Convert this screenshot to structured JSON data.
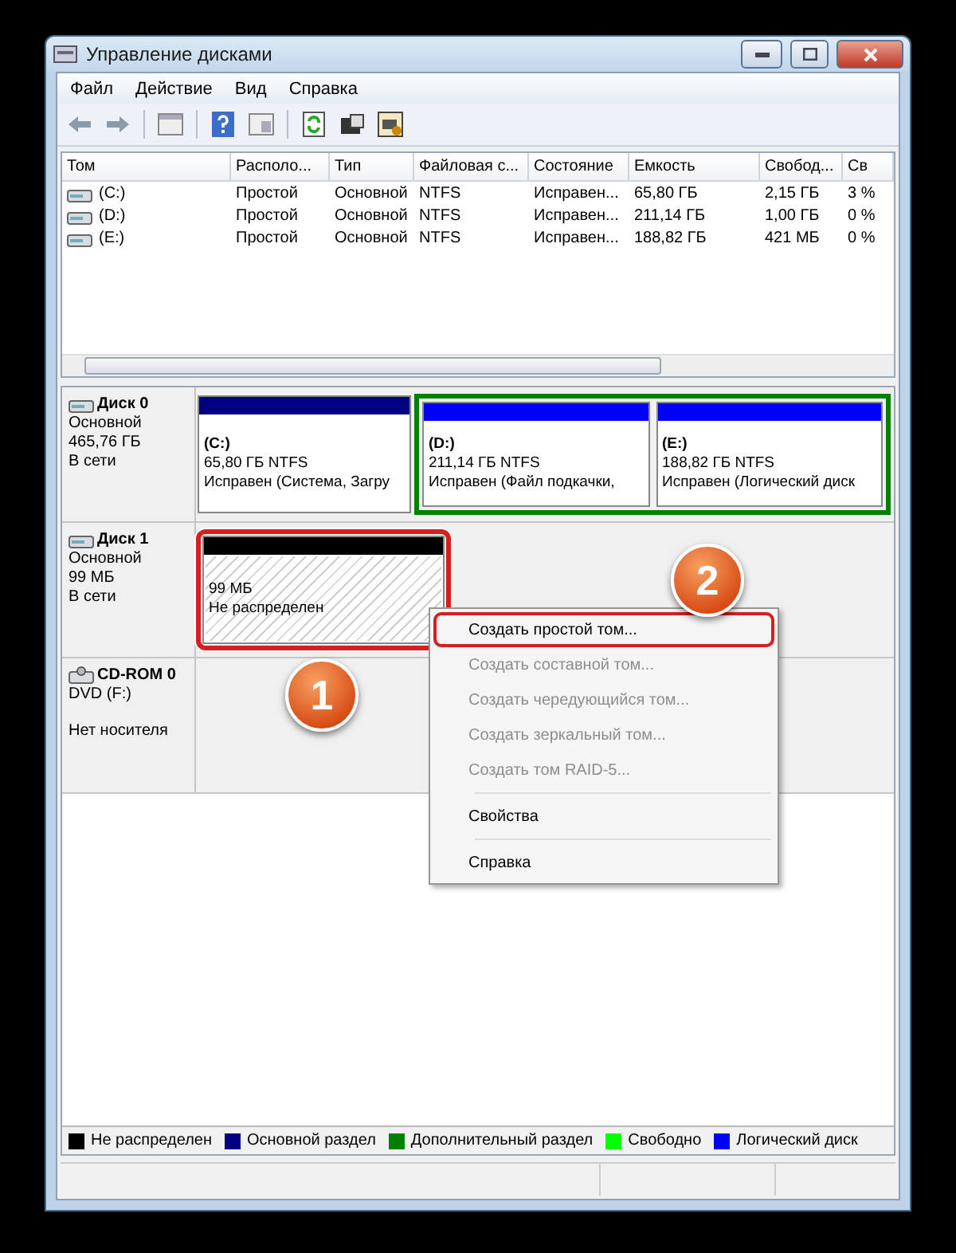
{
  "window": {
    "title": "Управление дисками"
  },
  "menu": [
    "Файл",
    "Действие",
    "Вид",
    "Справка"
  ],
  "table": {
    "columns": [
      "Том",
      "Располо...",
      "Тип",
      "Файловая с...",
      "Состояние",
      "Емкость",
      "Свобод...",
      "Св"
    ],
    "rows": [
      [
        "(C:)",
        "Простой",
        "Основной",
        "NTFS",
        "Исправен...",
        "65,80 ГБ",
        "2,15 ГБ",
        "3 %"
      ],
      [
        "(D:)",
        "Простой",
        "Основной",
        "NTFS",
        "Исправен...",
        "211,14 ГБ",
        "1,00 ГБ",
        "0 %"
      ],
      [
        "(E:)",
        "Простой",
        "Основной",
        "NTFS",
        "Исправен...",
        "188,82 ГБ",
        "421 МБ",
        "0 %"
      ]
    ]
  },
  "disks": [
    {
      "kind": "hdd",
      "name": "Диск 0",
      "type": "Основной",
      "size": "465,76 ГБ",
      "status": "В сети",
      "partitions": [
        {
          "kind": "volume",
          "color": "#000080",
          "highlighted": false,
          "label": "(C:)",
          "size": "65,80 ГБ NTFS",
          "status": "Исправен (Система, Загру"
        },
        {
          "kind": "extended",
          "color": "#008000",
          "children": [
            {
              "kind": "volume",
              "color": "#0000ff",
              "highlighted": false,
              "label": "(D:)",
              "size": "211,14 ГБ NTFS",
              "status": "Исправен (Файл подкачки,"
            },
            {
              "kind": "volume",
              "color": "#0000ff",
              "highlighted": false,
              "label": "(E:)",
              "size": "188,82 ГБ NTFS",
              "status": "Исправен (Логический диск"
            }
          ]
        }
      ]
    },
    {
      "kind": "hdd",
      "name": "Диск 1",
      "type": "Основной",
      "size": "99 МБ",
      "status": "В сети",
      "partitions": [
        {
          "kind": "unallocated",
          "color": "#000000",
          "highlighted": true,
          "size": "99 МБ",
          "status": "Не распределен"
        }
      ]
    },
    {
      "kind": "cdrom",
      "name": "CD-ROM 0",
      "type": "DVD (F:)",
      "status": "Нет носителя"
    }
  ],
  "legend": [
    {
      "color": "#000000",
      "label": "Не распределен"
    },
    {
      "color": "#000080",
      "label": "Основной раздел"
    },
    {
      "color": "#008000",
      "label": "Дополнительный раздел"
    },
    {
      "color": "#00ff00",
      "label": "Свободно"
    },
    {
      "color": "#0000ff",
      "label": "Логический диск"
    }
  ],
  "context_menu": [
    {
      "kind": "item",
      "label": "Создать простой том...",
      "disabled": false,
      "highlighted": true
    },
    {
      "kind": "item",
      "label": "Создать составной том...",
      "disabled": true,
      "highlighted": false
    },
    {
      "kind": "item",
      "label": "Создать чередующийся том...",
      "disabled": true,
      "highlighted": false
    },
    {
      "kind": "item",
      "label": "Создать зеркальный том...",
      "disabled": true,
      "highlighted": false
    },
    {
      "kind": "item",
      "label": "Создать том RAID-5...",
      "disabled": true,
      "highlighted": false
    },
    {
      "kind": "separator"
    },
    {
      "kind": "item",
      "label": "Свойства",
      "disabled": false,
      "highlighted": false
    },
    {
      "kind": "separator"
    },
    {
      "kind": "item",
      "label": "Справка",
      "disabled": false,
      "highlighted": false
    }
  ],
  "step_badges": [
    "1",
    "2"
  ]
}
